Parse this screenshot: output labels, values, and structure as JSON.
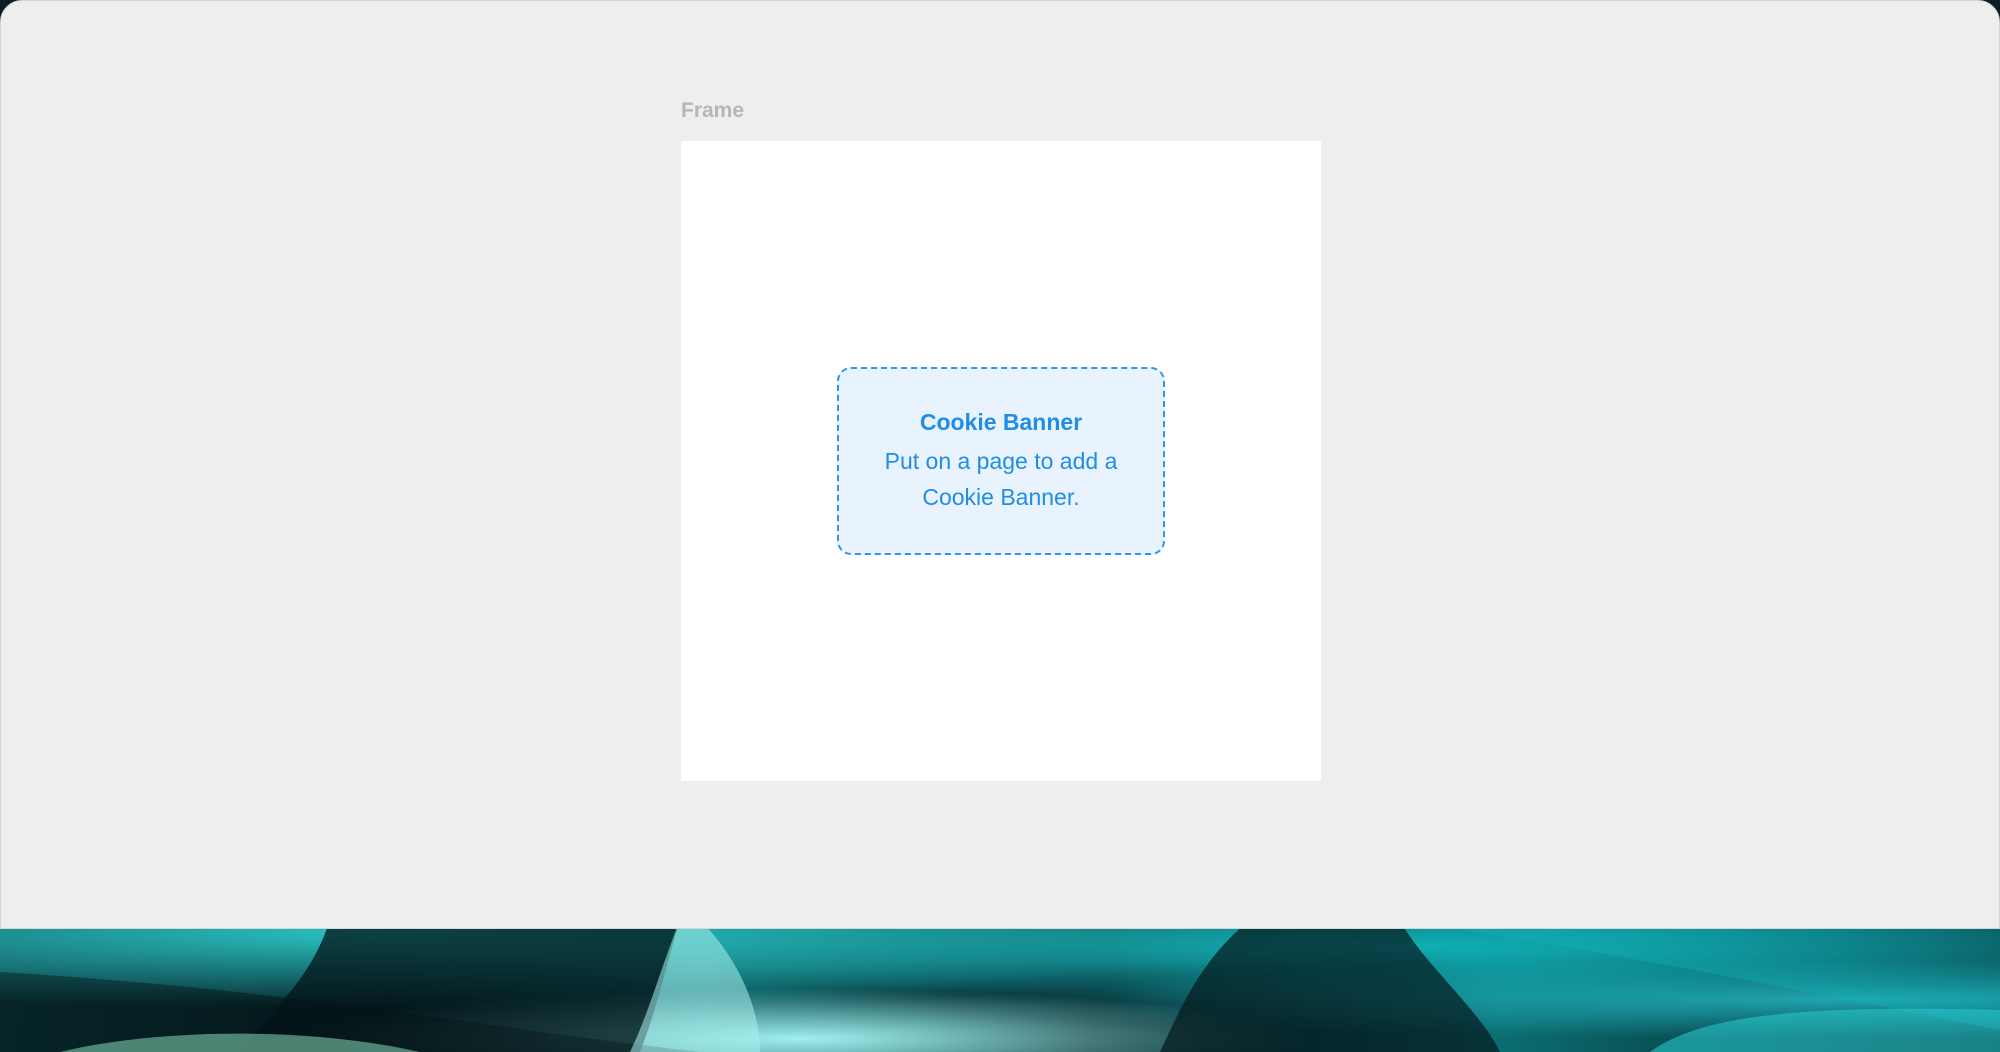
{
  "canvas": {
    "frame_label": "Frame"
  },
  "component": {
    "title": "Cookie Banner",
    "description": "Put on a page to add a Cookie Banner."
  },
  "colors": {
    "canvas_bg": "#eeeeee",
    "frame_bg": "#ffffff",
    "accent": "#1f8ee4",
    "placeholder_bg": "#e8f3fd"
  }
}
